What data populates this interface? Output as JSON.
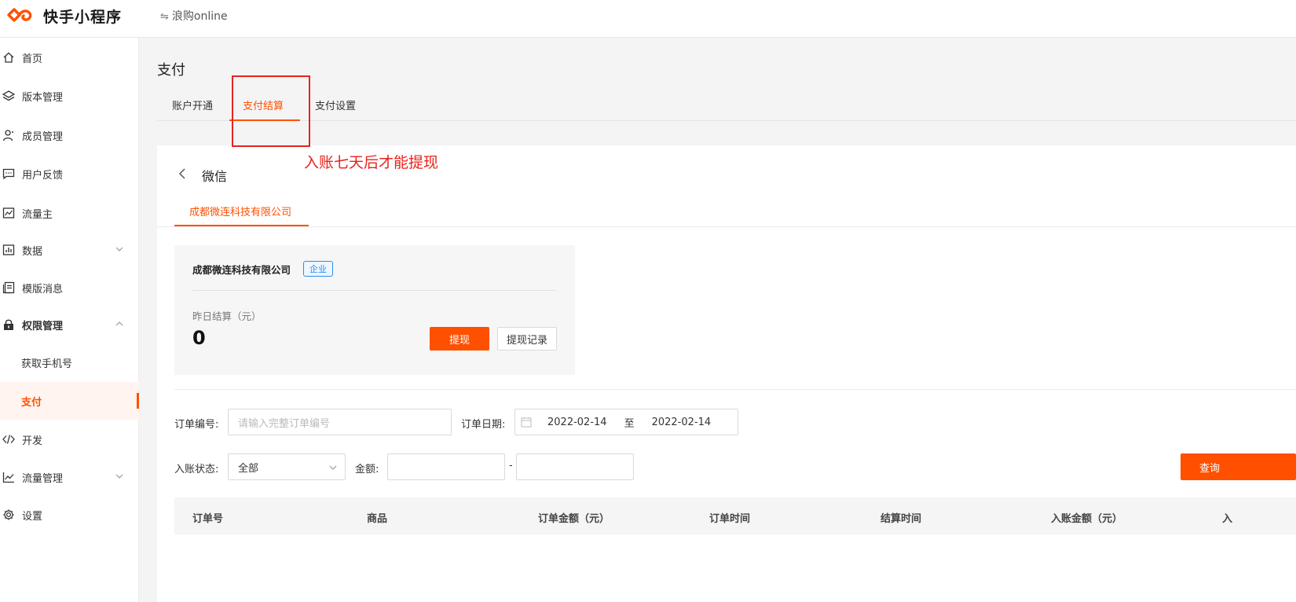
{
  "header": {
    "app_title": "快手小程序",
    "app_switch_label": "浪购online"
  },
  "sidebar": {
    "items": [
      {
        "label": "首页",
        "icon": "home-icon"
      },
      {
        "label": "版本管理",
        "icon": "layers-icon"
      },
      {
        "label": "成员管理",
        "icon": "user-icon"
      },
      {
        "label": "用户反馈",
        "icon": "message-icon"
      },
      {
        "label": "流量主",
        "icon": "chart-box-icon"
      },
      {
        "label": "数据",
        "icon": "bar-chart-icon",
        "expandable": true
      },
      {
        "label": "模版消息",
        "icon": "template-icon"
      },
      {
        "label": "权限管理",
        "icon": "lock-icon",
        "expanded": true
      },
      {
        "label": "获取手机号",
        "sub": true
      },
      {
        "label": "支付",
        "sub": true,
        "active": true
      },
      {
        "label": "开发",
        "icon": "code-icon"
      },
      {
        "label": "流量管理",
        "icon": "line-chart-icon",
        "expandable": true
      },
      {
        "label": "设置",
        "icon": "gear-icon"
      }
    ]
  },
  "page": {
    "title": "支付",
    "tabs": [
      "账户开通",
      "支付结算",
      "支付设置"
    ],
    "active_tab": "支付结算",
    "annotation": "入账七天后才能提现"
  },
  "card": {
    "title": "微信",
    "sub_tab": "成都微连科技有限公司",
    "account": {
      "name": "成都微连科技有限公司",
      "tag": "企业",
      "settle_label": "昨日结算（元）",
      "settle_value": "0",
      "withdraw_button": "提现",
      "records_button": "提现记录"
    }
  },
  "filters": {
    "order_no_label": "订单编号:",
    "order_no_placeholder": "请输入完整订单编号",
    "order_date_label": "订单日期:",
    "date_from": "2022-02-14",
    "date_sep": "至",
    "date_to": "2022-02-14",
    "status_label": "入账状态:",
    "status_value": "全部",
    "amount_label": "金额:",
    "amount_dash": "-",
    "query_button": "查询"
  },
  "table": {
    "columns": [
      "订单号",
      "商品",
      "订单金额（元）",
      "订单时间",
      "结算时间",
      "入账金额（元）",
      "入"
    ]
  },
  "colors": {
    "accent": "#ff5000",
    "annotation": "#e8231d",
    "tag_blue": "#2d8cf0"
  }
}
